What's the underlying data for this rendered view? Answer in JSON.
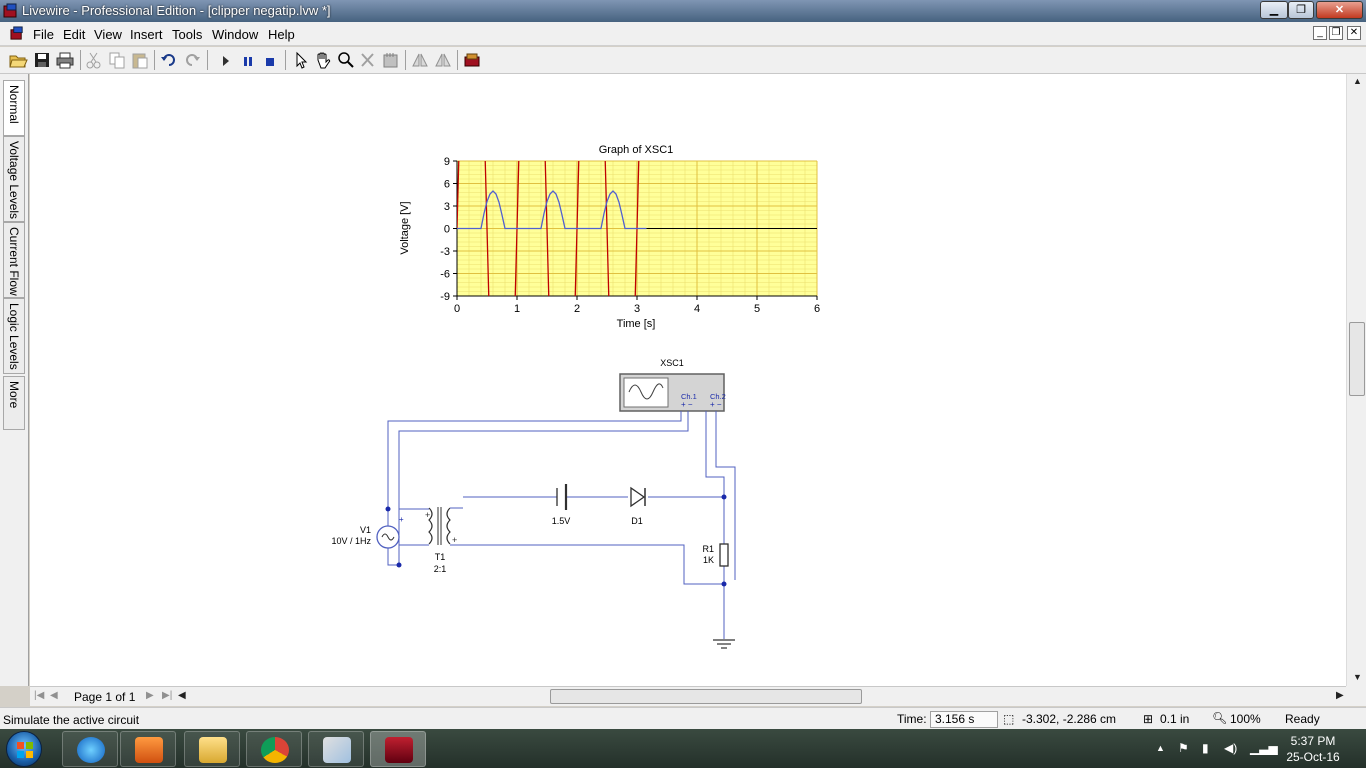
{
  "window": {
    "title": "Livewire - Professional Edition - [clipper negatip.lvw *]"
  },
  "menu": {
    "items": [
      "File",
      "Edit",
      "View",
      "Insert",
      "Tools",
      "Window",
      "Help"
    ]
  },
  "left_tabs": [
    "Normal",
    "Voltage Levels",
    "Current Flow",
    "Logic Levels",
    "More"
  ],
  "graph": {
    "title": "Graph of XSC1",
    "xlabel": "Time [s]",
    "ylabel": "Voltage [V]",
    "xticks": [
      "0",
      "1",
      "2",
      "3",
      "4",
      "5",
      "6"
    ],
    "yticks": [
      "9",
      "6",
      "3",
      "0",
      "-3",
      "-6",
      "-9"
    ]
  },
  "chart_data": {
    "type": "line",
    "title": "Graph of XSC1",
    "xlabel": "Time [s]",
    "ylabel": "Voltage [V]",
    "xlim": [
      0,
      6
    ],
    "ylim": [
      -9,
      9
    ],
    "grid": true,
    "background": "#ffff99",
    "series": [
      {
        "color": "#c00000",
        "x": [
          0,
          0.0625,
          0.125,
          0.1875,
          0.25,
          0.3125,
          0.375,
          0.4375,
          0.5,
          0.5625,
          0.625,
          0.6875,
          0.75,
          0.8125,
          0.875,
          0.9375,
          1,
          1.0625,
          1.125,
          1.1875,
          1.25,
          1.3125,
          1.375,
          1.4375,
          1.5,
          1.5625,
          1.625,
          1.6875,
          1.75,
          1.8125,
          1.875,
          1.9375,
          2,
          2.0625,
          2.125,
          2.1875,
          2.25,
          2.3125,
          2.375,
          2.4375,
          2.5,
          2.5625,
          2.625,
          2.6875,
          2.75,
          2.8125,
          2.875,
          2.9375,
          3,
          3.0625,
          3.125,
          3.156
        ],
        "y": [
          0,
          19.1,
          35.4,
          46.2,
          50,
          46.2,
          35.4,
          19.1,
          0,
          -19.1,
          -35.4,
          -46.2,
          -50,
          -46.2,
          -35.4,
          -19.1,
          0,
          19.1,
          35.4,
          46.2,
          50,
          46.2,
          35.4,
          19.1,
          0,
          -19.1,
          -35.4,
          -46.2,
          -50,
          -46.2,
          -35.4,
          -19.1,
          0,
          19.1,
          35.4,
          46.2,
          50,
          46.2,
          35.4,
          19.1,
          0,
          -19.1,
          -35.4,
          -46.2,
          -50,
          -46.2,
          -35.4,
          -19.1,
          0,
          19.1,
          35.4,
          46.2
        ]
      },
      {
        "color": "#5060d0",
        "x": [
          0,
          0.1,
          0.2,
          0.3,
          0.4,
          0.45,
          0.5,
          0.55,
          0.6,
          0.65,
          0.7,
          0.75,
          0.8,
          0.9,
          1.0,
          1.1,
          1.2,
          1.3,
          1.4,
          1.45,
          1.5,
          1.55,
          1.6,
          1.65,
          1.7,
          1.75,
          1.8,
          1.9,
          2.0,
          2.1,
          2.2,
          2.3,
          2.4,
          2.45,
          2.5,
          2.55,
          2.6,
          2.65,
          2.7,
          2.75,
          2.8,
          2.9,
          3.0,
          3.1,
          3.156
        ],
        "y": [
          0,
          0,
          0,
          0,
          0,
          2.0,
          3.6,
          4.6,
          5.0,
          4.6,
          3.5,
          1.8,
          0,
          0,
          0,
          0,
          0,
          0,
          0,
          2.0,
          3.6,
          4.6,
          5.0,
          4.6,
          3.5,
          1.8,
          0,
          0,
          0,
          0,
          0,
          0,
          0,
          2.0,
          3.6,
          4.6,
          5.0,
          4.6,
          3.5,
          1.8,
          0,
          0,
          0,
          0,
          0
        ]
      }
    ]
  },
  "circuit": {
    "scope_label": "XSC1",
    "ch1_label": "Ch.1",
    "ch2_label": "Ch.2",
    "scope_polarity": "+ −",
    "v1_label": "V1",
    "v1_value": "10V / 1Hz",
    "t1_label": "T1",
    "t1_ratio": "2:1",
    "battery_value": "1.5V",
    "diode_label": "D1",
    "r1_label": "R1",
    "r1_value": "1K",
    "plus": "+",
    "minus": "−"
  },
  "pagebar": {
    "page_label": "Page 1 of 1"
  },
  "status": {
    "message": "Simulate the active circuit",
    "time_label": "Time:",
    "time_value": "3.156 s",
    "coords": "-3.302, -2.286 cm",
    "grid": "0.1 in",
    "zoom": "100%",
    "state": "Ready"
  },
  "taskbar": {
    "time": "5:37 PM",
    "date": "25-Oct-16"
  }
}
